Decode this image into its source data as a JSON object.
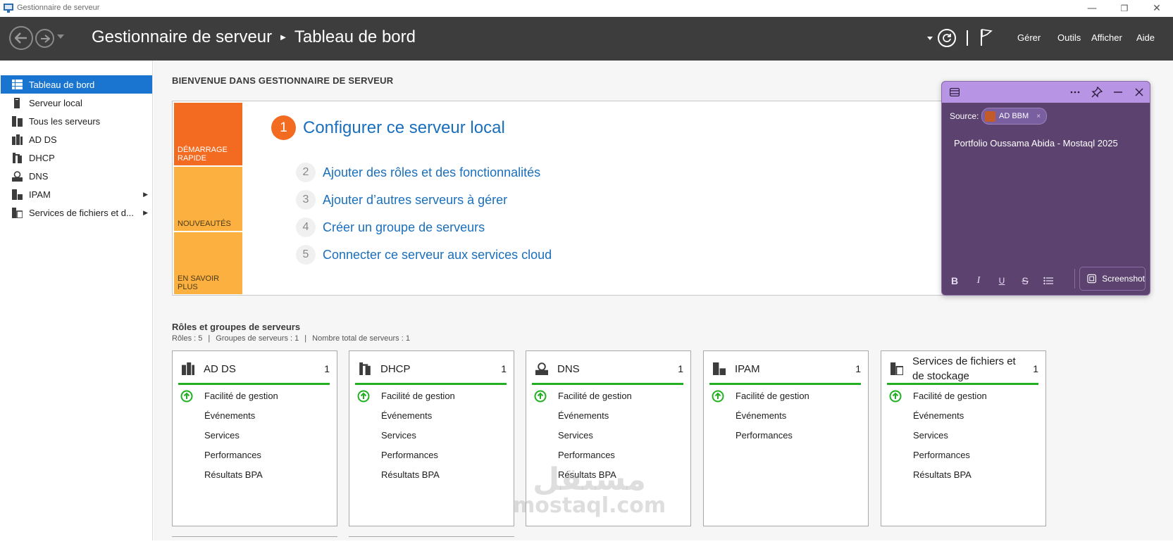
{
  "window": {
    "title": "Gestionnaire de serveur",
    "buttons": {
      "minimize": "—",
      "restore": "❐",
      "close": "✕"
    }
  },
  "header": {
    "breadcrumb_root": "Gestionnaire de serveur",
    "breadcrumb_current": "Tableau de bord",
    "menus": {
      "manage": "Gérer",
      "tools": "Outils",
      "view": "Afficher",
      "help": "Aide"
    },
    "icons": [
      "back-icon",
      "forward-icon",
      "dropdown-icon",
      "refresh-icon",
      "notifications-flag-icon"
    ]
  },
  "sidebar": {
    "items": [
      {
        "label": "Tableau de bord",
        "icon": "dashboard-icon",
        "active": true
      },
      {
        "label": "Serveur local",
        "icon": "local-server-icon"
      },
      {
        "label": "Tous les serveurs",
        "icon": "all-servers-icon"
      },
      {
        "label": "AD DS",
        "icon": "ad-ds-icon"
      },
      {
        "label": "DHCP",
        "icon": "dhcp-icon"
      },
      {
        "label": "DNS",
        "icon": "dns-icon"
      },
      {
        "label": "IPAM",
        "icon": "ipam-icon",
        "expandable": true
      },
      {
        "label": "Services de fichiers et d...",
        "icon": "file-services-icon",
        "expandable": true
      }
    ]
  },
  "welcome": {
    "title": "BIENVENUE DANS GESTIONNAIRE DE SERVEUR",
    "tiles": [
      "DÉMARRAGE RAPIDE",
      "NOUVEAUTÉS",
      "EN SAVOIR PLUS"
    ],
    "steps": [
      {
        "num": "1",
        "label": "Configurer ce serveur local"
      },
      {
        "num": "2",
        "label": "Ajouter des rôles et des fonctionnalités"
      },
      {
        "num": "3",
        "label": "Ajouter d’autres serveurs à gérer"
      },
      {
        "num": "4",
        "label": "Créer un groupe de serveurs"
      },
      {
        "num": "5",
        "label": "Connecter ce serveur aux services cloud"
      }
    ]
  },
  "roles": {
    "title": "Rôles et groupes de serveurs",
    "summary": [
      "Rôles : 5",
      "|",
      "Groupes de serveurs : 1",
      "|",
      "Nombre total de serveurs : 1"
    ],
    "cards": [
      {
        "name": "AD DS",
        "count": "1",
        "icon": "ad-ds-icon",
        "rows": [
          "Facilité de gestion",
          "Événements",
          "Services",
          "Performances",
          "Résultats BPA"
        ]
      },
      {
        "name": "DHCP",
        "count": "1",
        "icon": "dhcp-icon",
        "rows": [
          "Facilité de gestion",
          "Événements",
          "Services",
          "Performances",
          "Résultats BPA"
        ]
      },
      {
        "name": "DNS",
        "count": "1",
        "icon": "dns-icon",
        "rows": [
          "Facilité de gestion",
          "Événements",
          "Services",
          "Performances",
          "Résultats BPA"
        ]
      },
      {
        "name": "IPAM",
        "count": "1",
        "icon": "ipam-icon",
        "rows": [
          "Facilité de gestion",
          "Événements",
          "Performances"
        ]
      },
      {
        "name": "Services de fichiers et de stockage",
        "count": "1",
        "icon": "file-services-icon",
        "rows": [
          "Facilité de gestion",
          "Événements",
          "Services",
          "Performances",
          "Résultats BPA"
        ]
      }
    ],
    "status_color": "#22b022"
  },
  "watermark": {
    "arabic": "مستقل",
    "latin": "mostaql.com"
  },
  "sticky_note": {
    "source_label": "Source:",
    "source_chip": "AD BBM",
    "chip_close": "×",
    "text": "Portfolio Oussama Abida - Mostaql 2025",
    "format_buttons": [
      "B",
      "I",
      "U",
      "S"
    ],
    "screenshot_label": "Screenshot",
    "colors": {
      "bar": "#b794e4",
      "body": "#5c426f"
    }
  },
  "colors": {
    "accent": "#1a75d1",
    "orange": "#f26b21",
    "amber": "#fbb040",
    "link": "#1a6fbd",
    "header": "#3d3d3d"
  }
}
